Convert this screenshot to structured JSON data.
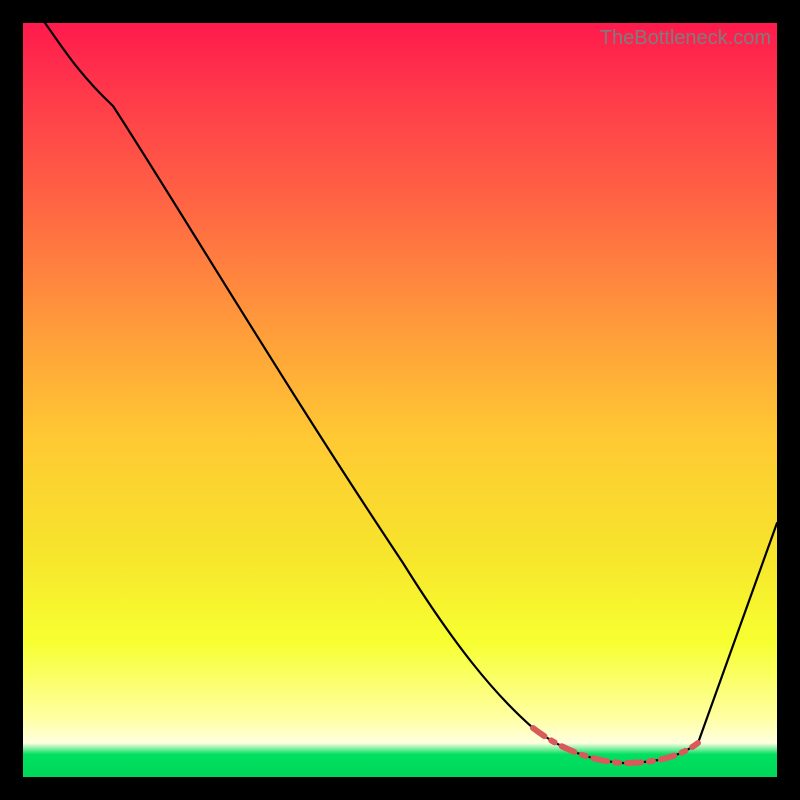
{
  "watermark": "TheBottleneck.com",
  "chart_data": {
    "type": "line",
    "title": "",
    "xlabel": "",
    "ylabel": "",
    "xlim": [
      0,
      100
    ],
    "ylim": [
      0,
      100
    ],
    "series": [
      {
        "name": "bottleneck-curve",
        "x": [
          3,
          7,
          12,
          18,
          24,
          30,
          36,
          42,
          48,
          54,
          58,
          62,
          66,
          70,
          74,
          78,
          82,
          86,
          89,
          92,
          95,
          98,
          100
        ],
        "y": [
          100,
          95,
          89,
          81,
          72,
          63,
          54,
          45,
          36,
          27,
          20,
          15,
          10,
          6,
          3.5,
          2.3,
          2.1,
          2.3,
          3.5,
          8,
          17,
          28,
          38
        ]
      },
      {
        "name": "optimal-range",
        "x": [
          70,
          74,
          78,
          82,
          86,
          89
        ],
        "y": [
          6,
          3.5,
          2.3,
          2.1,
          2.3,
          3.5
        ]
      }
    ],
    "grid": false,
    "legend": false
  }
}
